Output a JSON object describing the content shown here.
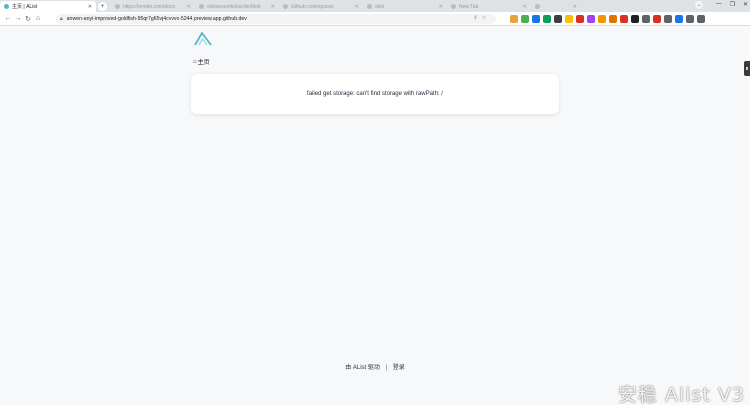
{
  "browser": {
    "active_tab": {
      "title": "主页 | AList"
    },
    "inactive_tabs": [
      {
        "title": "https://render.com/docs"
      },
      {
        "title": "shikansen/tieba-lite/blob"
      },
      {
        "title": "Github codespaces"
      },
      {
        "title": "alist"
      },
      {
        "title": "New Tab"
      },
      {
        "title": ""
      }
    ],
    "url_host": "anwen-anyi-improved-goldfish-95qr7g65vj4cvvvx-5244.preview.app.github.dev",
    "extension_colors": [
      "#e8a33a",
      "#4caf50",
      "#1a73e8",
      "#0f9d58",
      "#3c4043",
      "#fbbc04",
      "#d93025",
      "#a142f4",
      "#f29900",
      "#e37400",
      "#d93025",
      "#202124",
      "#5f6368",
      "#d93025",
      "#5f6368",
      "#1a73e8",
      "#5f6368",
      "#5f6368"
    ]
  },
  "page": {
    "breadcrumb_home": "主页",
    "error_message": "failed get storage: can't find storage with rawPath: /",
    "footer": {
      "powered_by": "由 AList 驱动",
      "separator": "|",
      "login": "登录"
    },
    "watermark": "安稳 Alist V3",
    "logo_color": "#5ab4c8"
  }
}
